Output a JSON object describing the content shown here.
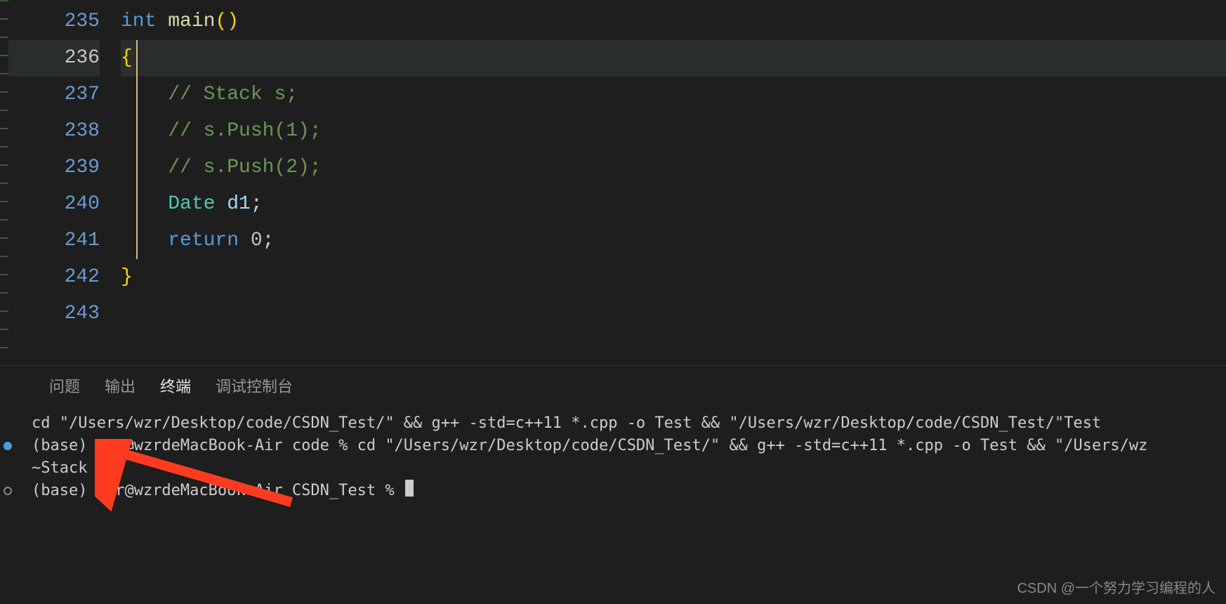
{
  "editor": {
    "lines": [
      {
        "num": "235",
        "tokens": [
          {
            "t": "keyword",
            "v": "int"
          },
          {
            "t": "punct",
            "v": " "
          },
          {
            "t": "func-name",
            "v": "main"
          },
          {
            "t": "paren",
            "v": "()"
          }
        ]
      },
      {
        "num": "236",
        "tokens": [
          {
            "t": "brace",
            "v": "{"
          }
        ],
        "active": true
      },
      {
        "num": "237",
        "tokens": [
          {
            "t": "punct",
            "v": "    "
          },
          {
            "t": "comment",
            "v": "// Stack s;"
          }
        ]
      },
      {
        "num": "238",
        "tokens": [
          {
            "t": "punct",
            "v": "    "
          },
          {
            "t": "comment",
            "v": "// s.Push(1);"
          }
        ]
      },
      {
        "num": "239",
        "tokens": [
          {
            "t": "punct",
            "v": "    "
          },
          {
            "t": "comment",
            "v": "// s.Push(2);"
          }
        ]
      },
      {
        "num": "240",
        "tokens": [
          {
            "t": "punct",
            "v": "    "
          },
          {
            "t": "type",
            "v": "Date"
          },
          {
            "t": "punct",
            "v": " "
          },
          {
            "t": "var",
            "v": "d1"
          },
          {
            "t": "punct",
            "v": ";"
          }
        ]
      },
      {
        "num": "241",
        "tokens": [
          {
            "t": "punct",
            "v": "    "
          },
          {
            "t": "keyword",
            "v": "return"
          },
          {
            "t": "punct",
            "v": " "
          },
          {
            "t": "number",
            "v": "0"
          },
          {
            "t": "punct",
            "v": ";"
          }
        ]
      },
      {
        "num": "242",
        "tokens": [
          {
            "t": "brace",
            "v": "}"
          }
        ]
      },
      {
        "num": "243",
        "tokens": []
      }
    ]
  },
  "panel": {
    "tabs": {
      "problems": "问题",
      "output": "输出",
      "terminal": "终端",
      "debug": "调试控制台"
    },
    "terminal": {
      "line1": "cd \"/Users/wzr/Desktop/code/CSDN_Test/\" && g++ -std=c++11 *.cpp -o Test && \"/Users/wzr/Desktop/code/CSDN_Test/\"Test",
      "line2": "(base) wzr@wzrdeMacBook-Air code % cd \"/Users/wzr/Desktop/code/CSDN_Test/\" && g++ -std=c++11 *.cpp -o Test && \"/Users/wz",
      "line3": "~Stack",
      "line4": "(base) wzr@wzrdeMacBook-Air CSDN_Test % "
    }
  },
  "watermark": "CSDN @一个努力学习编程的人"
}
